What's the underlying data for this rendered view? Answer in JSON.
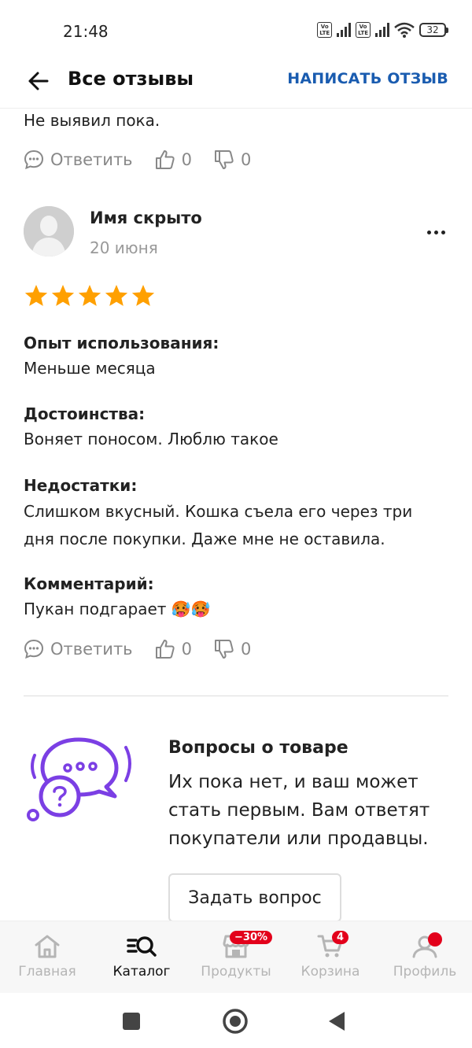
{
  "status_bar": {
    "time": "21:48",
    "volte": "Vo\nLTE",
    "battery": "32"
  },
  "header": {
    "title": "Все отзывы",
    "write_review": "НАПИСАТЬ ОТЗЫВ",
    "back_icon": "arrow-left-icon"
  },
  "prev_review": {
    "text": "Не выявил пока.",
    "reply_label": "Ответить",
    "likes": "0",
    "dislikes": "0"
  },
  "review": {
    "author": "Имя скрыто",
    "date": "20 июня",
    "rating": 5,
    "sections": [
      {
        "label": "Опыт использования:",
        "text": "Меньше месяца"
      },
      {
        "label": "Достоинства:",
        "text": "Воняет поносом. Люблю такое"
      },
      {
        "label": "Недостатки:",
        "text_lines": [
          "Слишком вкусный. Кошка съела его через три",
          "дня после покупки. Даже мне не оставила."
        ]
      },
      {
        "label": "Комментарий:",
        "text": "Пукан подгарает 🥵🥵"
      }
    ],
    "reply_label": "Ответить",
    "likes": "0",
    "dislikes": "0"
  },
  "questions": {
    "title": "Вопросы о товаре",
    "text_lines": [
      "Их пока нет, и ваш может",
      "стать первым. Вам ответят",
      "покупатели или продавцы."
    ],
    "ask_button": "Задать вопрос",
    "accent_color": "#7b3fe4"
  },
  "bottom_nav": {
    "items": [
      {
        "label": "Главная",
        "icon": "home-icon"
      },
      {
        "label": "Каталог",
        "icon": "catalog-search-icon",
        "active": true
      },
      {
        "label": "Продукты",
        "icon": "store-icon",
        "badge": "−30%"
      },
      {
        "label": "Корзина",
        "icon": "cart-icon",
        "badge": "4"
      },
      {
        "label": "Профиль",
        "icon": "profile-icon",
        "dot": true
      }
    ],
    "badge_color": "#e3001b"
  },
  "colors": {
    "link": "#1a5cb0",
    "star": "#ffa000",
    "muted": "#888888"
  }
}
